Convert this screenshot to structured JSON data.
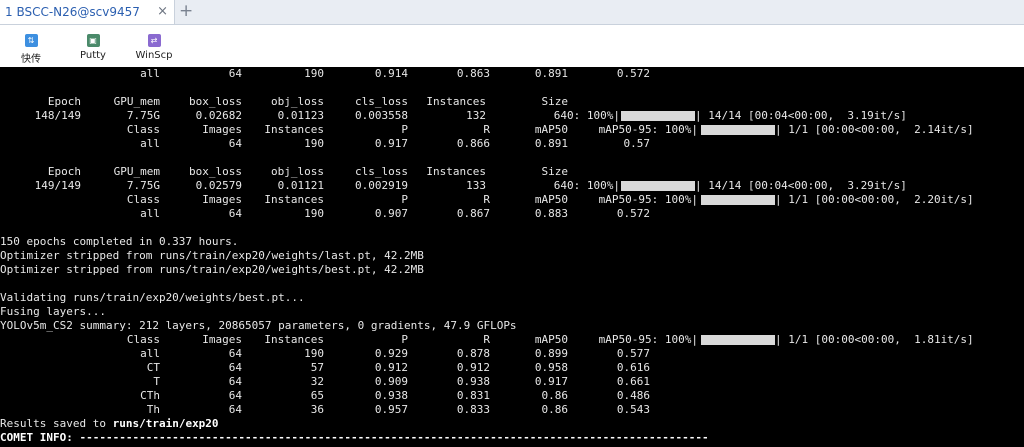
{
  "tab": {
    "label": "1 BSCC-N26@scv9457",
    "close": "×",
    "add": "+"
  },
  "toolbar": {
    "items": [
      {
        "label": "快传",
        "icon": "quick-transfer-icon",
        "color": "#3d8fe0"
      },
      {
        "label": "Putty",
        "icon": "putty-icon",
        "color": "#4a8a6a"
      },
      {
        "label": "WinScp",
        "icon": "winscp-icon",
        "color": "#8a6ad0"
      }
    ]
  },
  "terminal": {
    "r_all0": [
      "all",
      "64",
      "190",
      "0.914",
      "0.863",
      "0.891",
      "0.572"
    ],
    "hdr1": [
      "Epoch",
      "GPU_mem",
      "box_loss",
      "obj_loss",
      "cls_loss",
      "Instances",
      "Size"
    ],
    "ep148": [
      "148/149",
      "7.75G",
      "0.02682",
      "0.01123",
      "0.003558",
      "132",
      "640: 100%|",
      "| 14/14 [00:04<00:00,  3.19it/s]"
    ],
    "val148hdr": [
      "Class",
      "Images",
      "Instances",
      "P",
      "R",
      "mAP50",
      "mAP50-95: 100%|",
      "| 1/1 [00:00<00:00,  2.14it/s]"
    ],
    "r_all148": [
      "all",
      "64",
      "190",
      "0.917",
      "0.866",
      "0.891",
      "0.57"
    ],
    "hdr2": [
      "Epoch",
      "GPU_mem",
      "box_loss",
      "obj_loss",
      "cls_loss",
      "Instances",
      "Size"
    ],
    "ep149": [
      "149/149",
      "7.75G",
      "0.02579",
      "0.01121",
      "0.002919",
      "133",
      "640: 100%|",
      "| 14/14 [00:04<00:00,  3.29it/s]"
    ],
    "val149hdr": [
      "Class",
      "Images",
      "Instances",
      "P",
      "R",
      "mAP50",
      "mAP50-95: 100%|",
      "| 1/1 [00:00<00:00,  2.20it/s]"
    ],
    "r_all149": [
      "all",
      "64",
      "190",
      "0.907",
      "0.867",
      "0.883",
      "0.572"
    ],
    "completed": "150 epochs completed in 0.337 hours.",
    "strip_last": "Optimizer stripped from runs/train/exp20/weights/last.pt, 42.2MB",
    "strip_best": "Optimizer stripped from runs/train/exp20/weights/best.pt, 42.2MB",
    "validating": "Validating runs/train/exp20/weights/best.pt...",
    "fusing": "Fusing layers...",
    "summary": "YOLOv5m_CS2 summary: 212 layers, 20865057 parameters, 0 gradients, 47.9 GFLOPs",
    "finalhdr": [
      "Class",
      "Images",
      "Instances",
      "P",
      "R",
      "mAP50",
      "mAP50-95: 100%|",
      "| 1/1 [00:00<00:00,  1.81it/s]"
    ],
    "final_rows": [
      [
        "all",
        "64",
        "190",
        "0.929",
        "0.878",
        "0.899",
        "0.577"
      ],
      [
        "CT",
        "64",
        "57",
        "0.912",
        "0.912",
        "0.958",
        "0.616"
      ],
      [
        "T",
        "64",
        "32",
        "0.909",
        "0.938",
        "0.917",
        "0.661"
      ],
      [
        "CTh",
        "64",
        "65",
        "0.938",
        "0.831",
        "0.86",
        "0.486"
      ],
      [
        "Th",
        "64",
        "36",
        "0.957",
        "0.833",
        "0.86",
        "0.543"
      ]
    ],
    "results_prefix": "Results saved to ",
    "results_path": "runs/train/exp20",
    "comet": "COMET INFO: -----------------------------------------------------------------------------------------------"
  }
}
